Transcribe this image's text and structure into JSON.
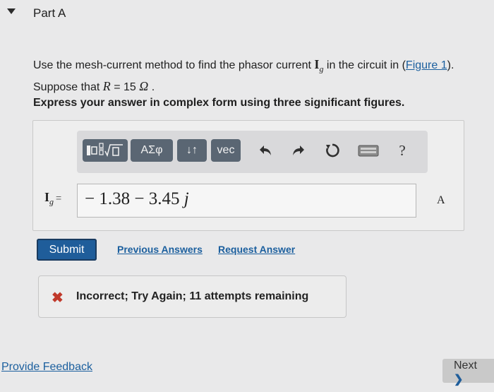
{
  "header": {
    "part_title": "Part A"
  },
  "question": {
    "text_1": "Use the mesh-current method to find the phasor current ",
    "var_main": "I",
    "var_sub": "g",
    "text_2": " in the circuit in (",
    "figure_link": "Figure 1",
    "text_3": ").",
    "text_4": "Suppose that ",
    "r_symbol": "R",
    "text_5": " = 15 ",
    "omega": "Ω",
    "text_6": " ."
  },
  "instruction": "Express your answer in complex form using three significant figures.",
  "toolbar": {
    "templates_icon": "templates-icon",
    "greek_label": "ΑΣφ",
    "arrows_label": "↓↑",
    "vec_label": "vec",
    "undo_icon": "undo-icon",
    "redo_icon": "redo-icon",
    "reset_icon": "reset-icon",
    "keyboard_icon": "keyboard-icon",
    "help_label": "?"
  },
  "answer": {
    "lhs_main": "I",
    "lhs_sub": "g",
    "lhs_eq": "=",
    "value": "− 1.38 − 3.45",
    "j": "j",
    "unit": "A"
  },
  "actions": {
    "submit_label": "Submit",
    "previous_answers": "Previous Answers",
    "request_answer": "Request Answer"
  },
  "feedback": {
    "icon": "x-icon",
    "text": "Incorrect; Try Again; 11 attempts remaining",
    "color": "#c0392b"
  },
  "footer": {
    "provide_feedback": "Provide Feedback",
    "next_label": "Next",
    "next_icon": "chevron-right-icon"
  },
  "colors": {
    "accent": "#1f5d9a",
    "link": "#1b5f9e",
    "toolbar_button": "#5a6673",
    "background": "#e9e9ea"
  }
}
